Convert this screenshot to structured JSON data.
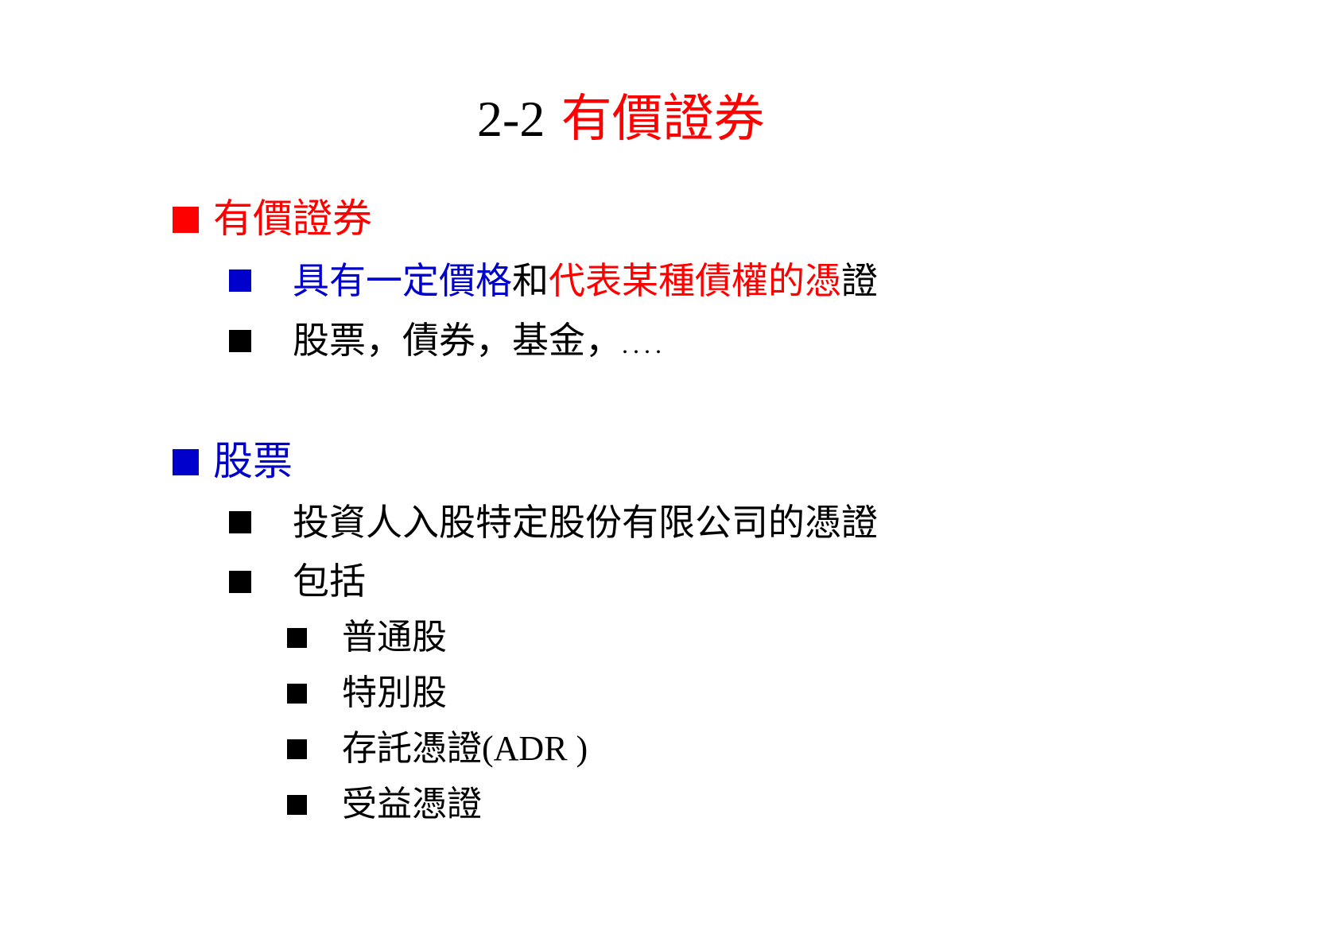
{
  "title": {
    "number": "2-2",
    "text": "有價證券"
  },
  "colors": {
    "red": "#ff0000",
    "blue": "#0000cc",
    "black": "#000000"
  },
  "sections": [
    {
      "heading": "有價證券",
      "items": [
        {
          "part_blue": "具有一定價格",
          "part_black": "和",
          "part_red": "代表某種債權的",
          "part_red2": "憑",
          "part_black2": "證"
        },
        {
          "text": "股票，債券，基金，",
          "dots": "...."
        }
      ]
    },
    {
      "heading": "股票",
      "items": [
        {
          "text": "投資人入股特定股份有限公司的憑證"
        },
        {
          "text": "包括",
          "subitems": [
            {
              "text": "普通股"
            },
            {
              "text": "特別股"
            },
            {
              "text_cjk": "存託憑證",
              "text_latin": "(ADR )"
            },
            {
              "text": "受益憑證"
            }
          ]
        }
      ]
    }
  ]
}
